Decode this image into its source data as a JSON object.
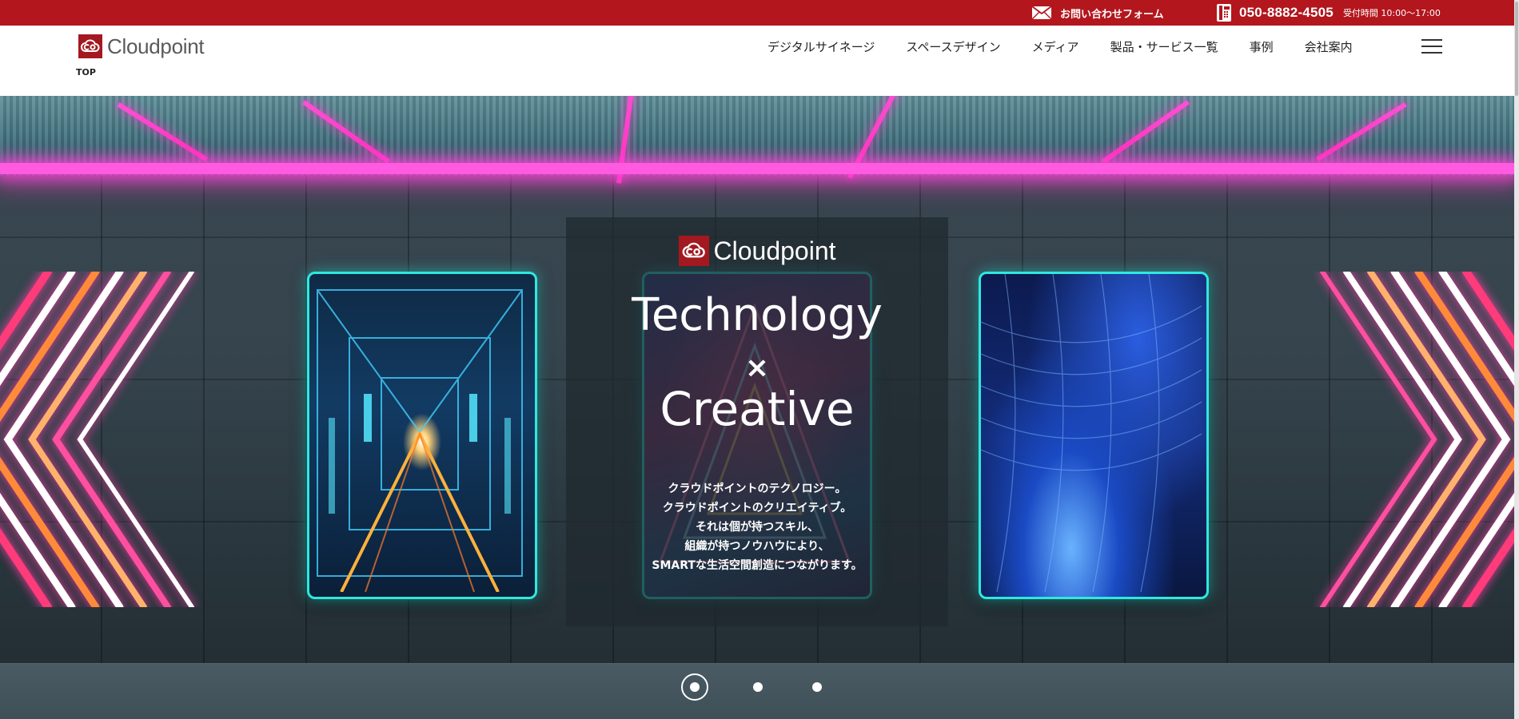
{
  "topbar": {
    "contact_label": "お問い合わせフォーム",
    "phone_number": "050-8882-4505",
    "hours": "受付時間 10:00〜17:00",
    "icons": [
      "mail-icon",
      "phone-icon"
    ],
    "background": "#b3161d"
  },
  "header": {
    "logo_text": "Cloudpoint",
    "breadcrumb": "TOP",
    "nav": [
      {
        "label": "デジタルサイネージ"
      },
      {
        "label": "スペースデザイン"
      },
      {
        "label": "メディア"
      },
      {
        "label": "製品・サービス一覧"
      },
      {
        "label": "事例"
      },
      {
        "label": "会社案内"
      }
    ],
    "menu_icon": "hamburger-menu-icon"
  },
  "hero": {
    "logo_text": "Cloudpoint",
    "title_line1": "Technology",
    "title_x": "×",
    "title_line2": "Creative",
    "body_lines": [
      "クラウドポイントのテクノロジー。",
      "クラウドポイントのクリエイティブ。",
      "それは個が持つスキル、",
      "組織が持つノウハウにより、",
      "SMARTな生活空間創造につながります。"
    ],
    "slides": [
      {
        "active": true
      },
      {
        "active": false
      },
      {
        "active": false
      }
    ],
    "accent_neon": "#ff4fd8",
    "panel_border": "#2ee8e0"
  },
  "brand_color": "#a3191f"
}
